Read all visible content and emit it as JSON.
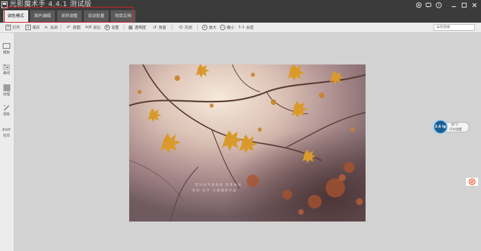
{
  "app": {
    "title": "光影魔术手 4.4.1 测试版"
  },
  "tabs": [
    {
      "label": "调色模式",
      "active": true
    },
    {
      "label": "图片编辑",
      "active": false
    },
    {
      "label": "采样调整",
      "active": false
    },
    {
      "label": "自动批量",
      "active": false
    },
    {
      "label": "项目文档",
      "active": false
    }
  ],
  "window_controls": [
    "settings-icon",
    "feedback-icon",
    "help-icon",
    "minimize-icon",
    "maximize-icon",
    "close-icon"
  ],
  "toolbar": {
    "open": "打开",
    "save": "保存",
    "close": "关闭",
    "prev": "原图",
    "compare": "对比",
    "compare_prefix": "A|B",
    "settings": "设置",
    "transparency": "透明度",
    "restore": "恢复",
    "history": "历史",
    "zoom_in": "放大",
    "zoom_out": "缩小",
    "one_to_one": "1:1",
    "fit": "合适"
  },
  "search": {
    "placeholder": "采样搜索"
  },
  "sidebar": {
    "items": [
      {
        "label": "模板",
        "icon": "template-icon"
      },
      {
        "label": "曲线",
        "icon": "curve-icon"
      },
      {
        "label": "纹理",
        "icon": "texture-icon"
      },
      {
        "label": "调色",
        "icon": "brush-icon"
      },
      {
        "label": "EXIF",
        "icon": "exif-icon"
      },
      {
        "label": "信息",
        "icon": "info-icon"
      }
    ]
  },
  "photo": {
    "watermark_line1": "若 时 光 不 再 温 柔 · 风 景 依 旧",
    "watermark_line2": "秋 色 · 红 叶 · 写 意 摄 影 作 品"
  },
  "cpu_widget": {
    "usage": "2.6 Ig",
    "temp": "35°C",
    "label": "CPU温度"
  },
  "colors": {
    "accent_highlight": "#d61f26",
    "titlebar": "#3b3b3b",
    "canvas": "#d2d2d2",
    "cpu_circle": "#1e5f93"
  }
}
